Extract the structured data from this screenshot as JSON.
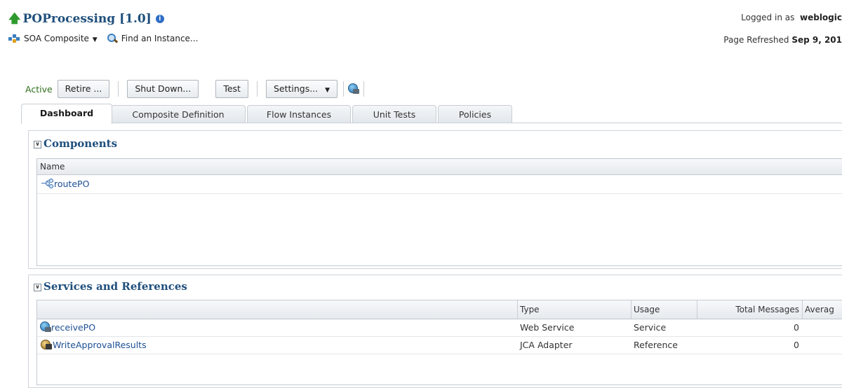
{
  "header": {
    "title": "POProcessing [1.0]",
    "info_glyph": "i",
    "soa_menu_label": "SOA Composite",
    "find_label": "Find an Instance...",
    "login_prefix": "Logged in as",
    "login_user": "weblogic",
    "refreshed_prefix": "Page Refreshed",
    "refreshed_value": "Sep 9, 201"
  },
  "toolbar": {
    "state": "Active",
    "retire": "Retire ...",
    "shutdown": "Shut Down...",
    "test": "Test",
    "settings": "Settings..."
  },
  "tabs": [
    "Dashboard",
    "Composite Definition",
    "Flow Instances",
    "Unit Tests",
    "Policies"
  ],
  "components": {
    "title": "Components",
    "header_name": "Name",
    "rows": [
      {
        "name": "routePO",
        "icon": "route-icon"
      }
    ]
  },
  "services": {
    "title": "Services and References",
    "headers": {
      "type": "Type",
      "usage": "Usage",
      "total": "Total Messages",
      "average": "Averag"
    },
    "rows": [
      {
        "name": "receivePO",
        "icon": "web-service-icon",
        "type": "Web Service",
        "usage": "Service",
        "total": "0"
      },
      {
        "name": "WriteApprovalResults",
        "icon": "jca-adapter-icon",
        "type": "JCA Adapter",
        "usage": "Reference",
        "total": "0"
      }
    ]
  },
  "colors": {
    "title": "#1f4f7c",
    "link": "#1d4f93",
    "active_state": "#2f6f1a",
    "up_arrow": "#2e9a2e"
  }
}
